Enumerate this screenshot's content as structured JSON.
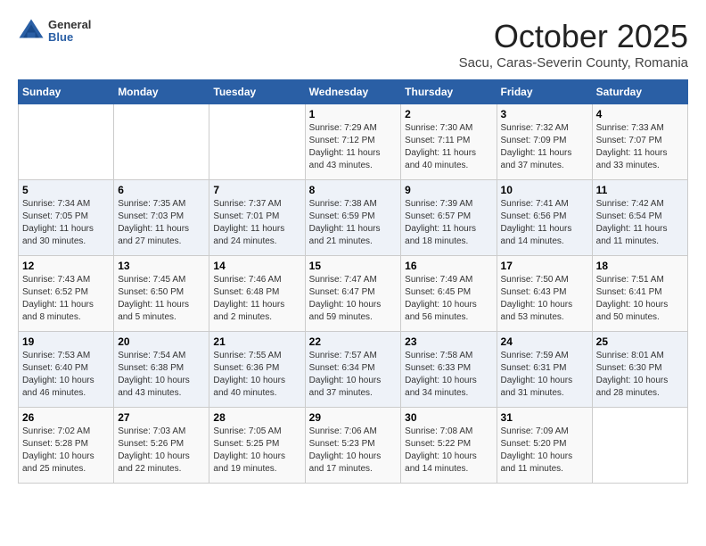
{
  "header": {
    "logo": {
      "line1": "General",
      "line2": "Blue"
    },
    "title": "October 2025",
    "subtitle": "Sacu, Caras-Severin County, Romania"
  },
  "weekdays": [
    "Sunday",
    "Monday",
    "Tuesday",
    "Wednesday",
    "Thursday",
    "Friday",
    "Saturday"
  ],
  "weeks": [
    [
      {
        "day": "",
        "info": ""
      },
      {
        "day": "",
        "info": ""
      },
      {
        "day": "",
        "info": ""
      },
      {
        "day": "1",
        "info": "Sunrise: 7:29 AM\nSunset: 7:12 PM\nDaylight: 11 hours\nand 43 minutes."
      },
      {
        "day": "2",
        "info": "Sunrise: 7:30 AM\nSunset: 7:11 PM\nDaylight: 11 hours\nand 40 minutes."
      },
      {
        "day": "3",
        "info": "Sunrise: 7:32 AM\nSunset: 7:09 PM\nDaylight: 11 hours\nand 37 minutes."
      },
      {
        "day": "4",
        "info": "Sunrise: 7:33 AM\nSunset: 7:07 PM\nDaylight: 11 hours\nand 33 minutes."
      }
    ],
    [
      {
        "day": "5",
        "info": "Sunrise: 7:34 AM\nSunset: 7:05 PM\nDaylight: 11 hours\nand 30 minutes."
      },
      {
        "day": "6",
        "info": "Sunrise: 7:35 AM\nSunset: 7:03 PM\nDaylight: 11 hours\nand 27 minutes."
      },
      {
        "day": "7",
        "info": "Sunrise: 7:37 AM\nSunset: 7:01 PM\nDaylight: 11 hours\nand 24 minutes."
      },
      {
        "day": "8",
        "info": "Sunrise: 7:38 AM\nSunset: 6:59 PM\nDaylight: 11 hours\nand 21 minutes."
      },
      {
        "day": "9",
        "info": "Sunrise: 7:39 AM\nSunset: 6:57 PM\nDaylight: 11 hours\nand 18 minutes."
      },
      {
        "day": "10",
        "info": "Sunrise: 7:41 AM\nSunset: 6:56 PM\nDaylight: 11 hours\nand 14 minutes."
      },
      {
        "day": "11",
        "info": "Sunrise: 7:42 AM\nSunset: 6:54 PM\nDaylight: 11 hours\nand 11 minutes."
      }
    ],
    [
      {
        "day": "12",
        "info": "Sunrise: 7:43 AM\nSunset: 6:52 PM\nDaylight: 11 hours\nand 8 minutes."
      },
      {
        "day": "13",
        "info": "Sunrise: 7:45 AM\nSunset: 6:50 PM\nDaylight: 11 hours\nand 5 minutes."
      },
      {
        "day": "14",
        "info": "Sunrise: 7:46 AM\nSunset: 6:48 PM\nDaylight: 11 hours\nand 2 minutes."
      },
      {
        "day": "15",
        "info": "Sunrise: 7:47 AM\nSunset: 6:47 PM\nDaylight: 10 hours\nand 59 minutes."
      },
      {
        "day": "16",
        "info": "Sunrise: 7:49 AM\nSunset: 6:45 PM\nDaylight: 10 hours\nand 56 minutes."
      },
      {
        "day": "17",
        "info": "Sunrise: 7:50 AM\nSunset: 6:43 PM\nDaylight: 10 hours\nand 53 minutes."
      },
      {
        "day": "18",
        "info": "Sunrise: 7:51 AM\nSunset: 6:41 PM\nDaylight: 10 hours\nand 50 minutes."
      }
    ],
    [
      {
        "day": "19",
        "info": "Sunrise: 7:53 AM\nSunset: 6:40 PM\nDaylight: 10 hours\nand 46 minutes."
      },
      {
        "day": "20",
        "info": "Sunrise: 7:54 AM\nSunset: 6:38 PM\nDaylight: 10 hours\nand 43 minutes."
      },
      {
        "day": "21",
        "info": "Sunrise: 7:55 AM\nSunset: 6:36 PM\nDaylight: 10 hours\nand 40 minutes."
      },
      {
        "day": "22",
        "info": "Sunrise: 7:57 AM\nSunset: 6:34 PM\nDaylight: 10 hours\nand 37 minutes."
      },
      {
        "day": "23",
        "info": "Sunrise: 7:58 AM\nSunset: 6:33 PM\nDaylight: 10 hours\nand 34 minutes."
      },
      {
        "day": "24",
        "info": "Sunrise: 7:59 AM\nSunset: 6:31 PM\nDaylight: 10 hours\nand 31 minutes."
      },
      {
        "day": "25",
        "info": "Sunrise: 8:01 AM\nSunset: 6:30 PM\nDaylight: 10 hours\nand 28 minutes."
      }
    ],
    [
      {
        "day": "26",
        "info": "Sunrise: 7:02 AM\nSunset: 5:28 PM\nDaylight: 10 hours\nand 25 minutes."
      },
      {
        "day": "27",
        "info": "Sunrise: 7:03 AM\nSunset: 5:26 PM\nDaylight: 10 hours\nand 22 minutes."
      },
      {
        "day": "28",
        "info": "Sunrise: 7:05 AM\nSunset: 5:25 PM\nDaylight: 10 hours\nand 19 minutes."
      },
      {
        "day": "29",
        "info": "Sunrise: 7:06 AM\nSunset: 5:23 PM\nDaylight: 10 hours\nand 17 minutes."
      },
      {
        "day": "30",
        "info": "Sunrise: 7:08 AM\nSunset: 5:22 PM\nDaylight: 10 hours\nand 14 minutes."
      },
      {
        "day": "31",
        "info": "Sunrise: 7:09 AM\nSunset: 5:20 PM\nDaylight: 10 hours\nand 11 minutes."
      },
      {
        "day": "",
        "info": ""
      }
    ]
  ]
}
